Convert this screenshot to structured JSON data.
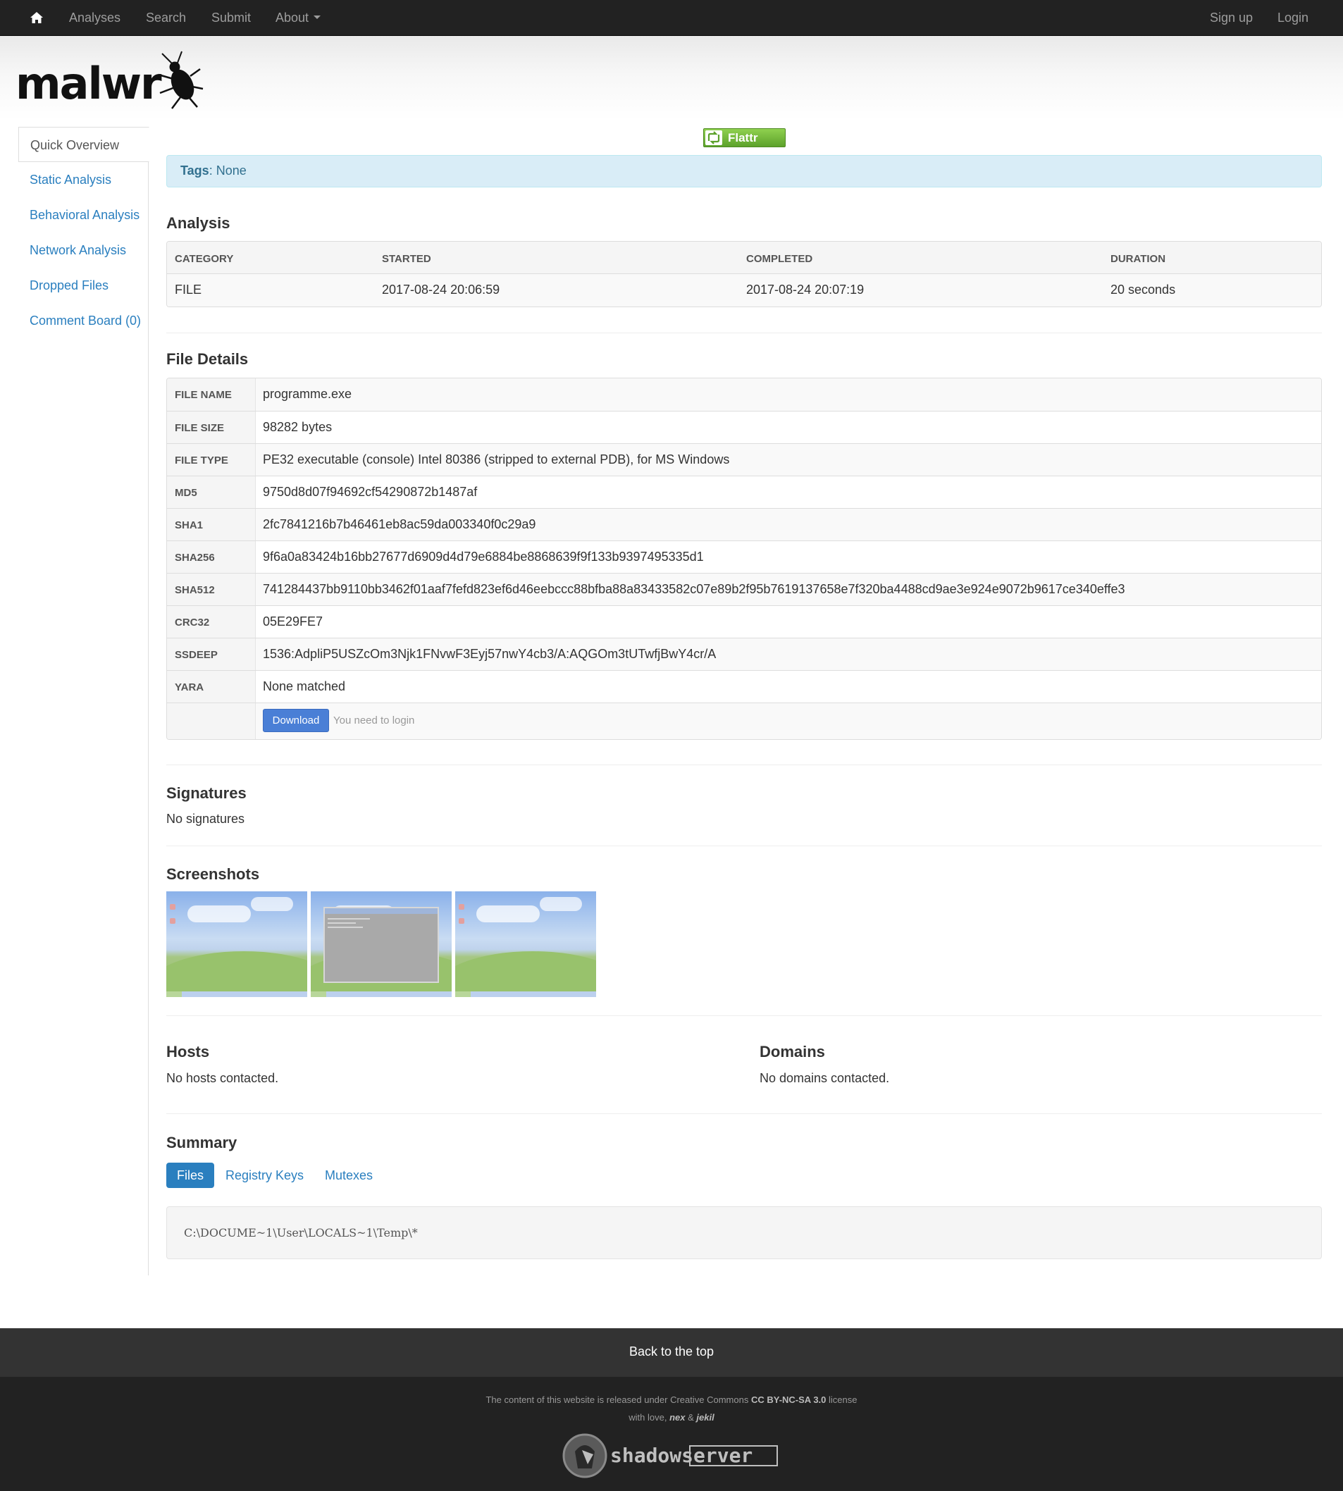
{
  "nav": {
    "items": [
      {
        "label": "Analyses"
      },
      {
        "label": "Search"
      },
      {
        "label": "Submit"
      },
      {
        "label": "About"
      }
    ],
    "right": [
      {
        "label": "Sign up"
      },
      {
        "label": "Login"
      }
    ]
  },
  "brand": {
    "logo_text": "malwr"
  },
  "sidebar": {
    "items": [
      {
        "label": "Quick Overview"
      },
      {
        "label": "Static Analysis"
      },
      {
        "label": "Behavioral Analysis"
      },
      {
        "label": "Network Analysis"
      },
      {
        "label": "Dropped Files"
      },
      {
        "label": "Comment Board (0)"
      }
    ]
  },
  "flattr": {
    "label": "Flattr"
  },
  "tags": {
    "label": "Tags",
    "value": "None"
  },
  "analysis": {
    "title": "Analysis",
    "headers": [
      "CATEGORY",
      "STARTED",
      "COMPLETED",
      "DURATION"
    ],
    "row": [
      "FILE",
      "2017-08-24 20:06:59",
      "2017-08-24 20:07:19",
      "20 seconds"
    ]
  },
  "file_details": {
    "title": "File Details",
    "rows": [
      {
        "key": "FILE NAME",
        "value": "programme.exe"
      },
      {
        "key": "FILE SIZE",
        "value": "98282 bytes"
      },
      {
        "key": "FILE TYPE",
        "value": "PE32 executable (console) Intel 80386 (stripped to external PDB), for MS Windows"
      },
      {
        "key": "MD5",
        "value": "9750d8d07f94692cf54290872b1487af"
      },
      {
        "key": "SHA1",
        "value": "2fc7841216b7b46461eb8ac59da003340f0c29a9"
      },
      {
        "key": "SHA256",
        "value": "9f6a0a83424b16bb27677d6909d4d79e6884be8868639f9f133b9397495335d1"
      },
      {
        "key": "SHA512",
        "value": "741284437bb9110bb3462f01aaf7fefd823ef6d46eebccc88bfba88a83433582c07e89b2f95b7619137658e7f320ba4488cd9ae3e924e9072b9617ce340effe3"
      },
      {
        "key": "CRC32",
        "value": "05E29FE7"
      },
      {
        "key": "SSDEEP",
        "value": "1536:AdpliP5USZcOm3Njk1FNvwF3Eyj57nwY4cb3/A:AQGOm3tUTwfjBwY4cr/A"
      },
      {
        "key": "YARA",
        "value": "None matched"
      }
    ],
    "download_label": "Download",
    "login_note": "You need to login"
  },
  "signatures": {
    "title": "Signatures",
    "text": "No signatures"
  },
  "screenshots": {
    "title": "Screenshots"
  },
  "hosts": {
    "title": "Hosts",
    "text": "No hosts contacted."
  },
  "domains": {
    "title": "Domains",
    "text": "No domains contacted."
  },
  "summary": {
    "title": "Summary",
    "tabs": [
      {
        "label": "Files",
        "active": true
      },
      {
        "label": "Registry Keys",
        "active": false
      },
      {
        "label": "Mutexes",
        "active": false
      }
    ],
    "files": [
      "C:\\DOCUME~1\\User\\LOCALS~1\\Temp\\*"
    ]
  },
  "footer": {
    "back_to_top": "Back to the top",
    "license_prefix": "The content of this website is released under Creative Commons",
    "license_name": "CC BY-NC-SA 3.0",
    "license_suffix": "license",
    "love_prefix": "with love,",
    "author1": "nex",
    "amp": "&",
    "author2": "jekil",
    "sponsor_logo": "shadowserver"
  },
  "colors": {
    "navbar": "#222222",
    "link": "#2a7fbf",
    "alert_bg": "#d9edf7",
    "download_btn": "#4a7fd6",
    "flattr_green": "#6aae35"
  }
}
